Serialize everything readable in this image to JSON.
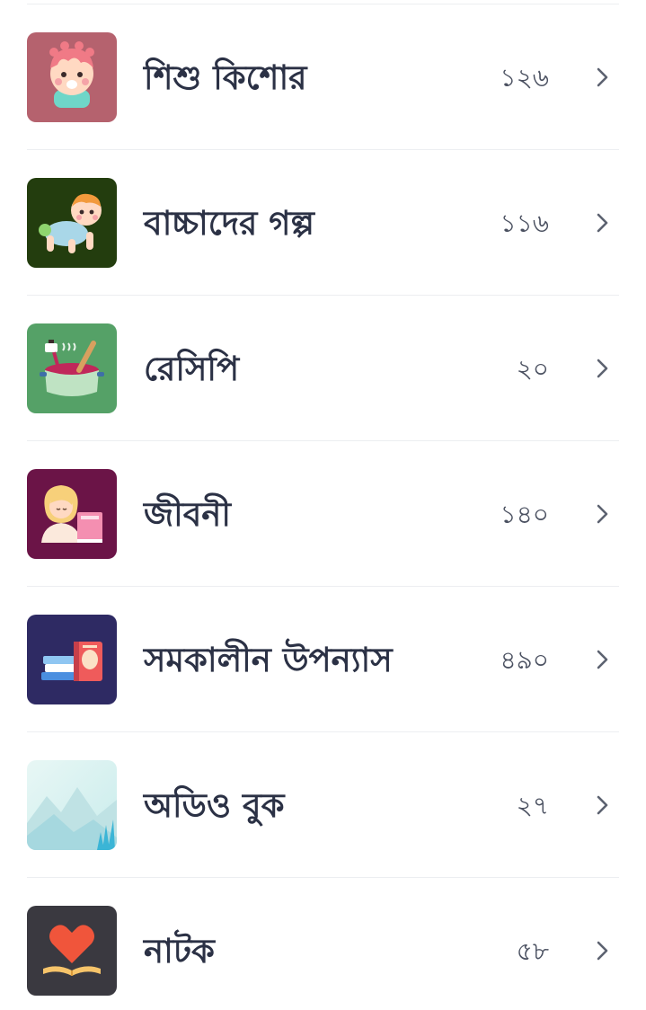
{
  "categories": [
    {
      "label": "শিশু কিশোর",
      "count": "১২৬",
      "icon": "kid-face-icon",
      "color": "#b5626e"
    },
    {
      "label": "বাচ্চাদের গল্প",
      "count": "১১৬",
      "icon": "crawling-baby-icon",
      "color": "#233d0e"
    },
    {
      "label": "রেসিপি",
      "count": "২০",
      "icon": "cooking-pot-icon",
      "color": "#55a167"
    },
    {
      "label": "জীবনী",
      "count": "১৪০",
      "icon": "person-with-book-icon",
      "color": "#6b1447"
    },
    {
      "label": "সমকালীন উপন্যাস",
      "count": "৪৯০",
      "icon": "books-stack-icon",
      "color": "#2e2a63"
    },
    {
      "label": "অডিও বুক",
      "count": "২৭",
      "icon": "landscape-icon",
      "color": "#d8f0ef"
    },
    {
      "label": "নাটক",
      "count": "৫৮",
      "icon": "heart-book-icon",
      "color": "#3a3940"
    }
  ]
}
